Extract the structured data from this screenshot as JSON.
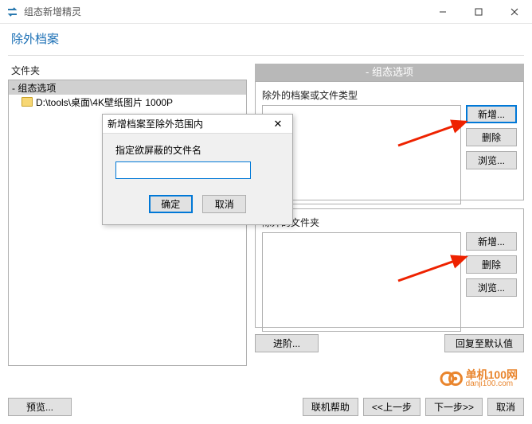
{
  "window": {
    "title": "组态新增精灵"
  },
  "header": {
    "page_title": "除外档案"
  },
  "left": {
    "label": "文件夹",
    "tree": [
      {
        "label": "- 组态选项",
        "selected": true
      },
      {
        "label": "D:\\tools\\桌面\\4K壁纸图片 1000P",
        "selected": false
      }
    ]
  },
  "right": {
    "group_header": "- 组态选项",
    "section1": {
      "label": "除外的档案或文件类型",
      "btn_new": "新增...",
      "btn_del": "删除",
      "btn_browse": "浏览..."
    },
    "section2": {
      "label": "除外的文件夹",
      "btn_new": "新增...",
      "btn_del": "删除",
      "btn_browse": "浏览..."
    },
    "advanced": "进阶...",
    "reset": "回复至默认值"
  },
  "footer": {
    "preview": "预览...",
    "help": "联机帮助",
    "prev": "<<上一步",
    "next": "下一步>>",
    "cancel": "取消"
  },
  "modal": {
    "title": "新增档案至除外范围内",
    "label": "指定欲屏蔽的文件名",
    "value": "",
    "ok": "确定",
    "cancel": "取消"
  },
  "watermark": {
    "line1": "单机100网",
    "line2": "danji100.com"
  }
}
